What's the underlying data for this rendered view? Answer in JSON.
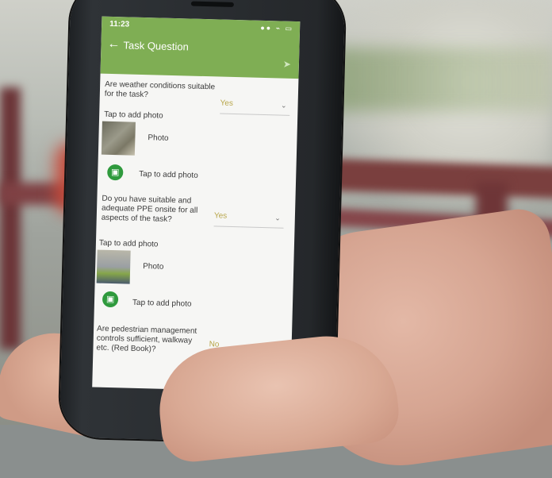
{
  "status": {
    "time": "11:23",
    "icons": "●● ⌁ ▭"
  },
  "header": {
    "title": "Task Question",
    "back_icon": "arrow-left-icon",
    "send_icon": "send-icon"
  },
  "questions": [
    {
      "text": "Are weather conditions suitable for the task?",
      "answer": "Yes",
      "tap_label": "Tap to add photo",
      "photo_label": "Photo",
      "add_photo_label": "Tap to add photo"
    },
    {
      "text": "Do you have suitable and adequate PPE onsite for all aspects of the task?",
      "answer": "Yes",
      "tap_label": "Tap to add photo",
      "photo_label": "Photo",
      "add_photo_label": "Tap to add photo"
    },
    {
      "text": "Are pedestrian management controls sufficient, walkway etc. (Red Book)?",
      "answer": "No"
    }
  ],
  "colors": {
    "appbar": "#7fae54",
    "camera_button": "#2f9a3d"
  }
}
